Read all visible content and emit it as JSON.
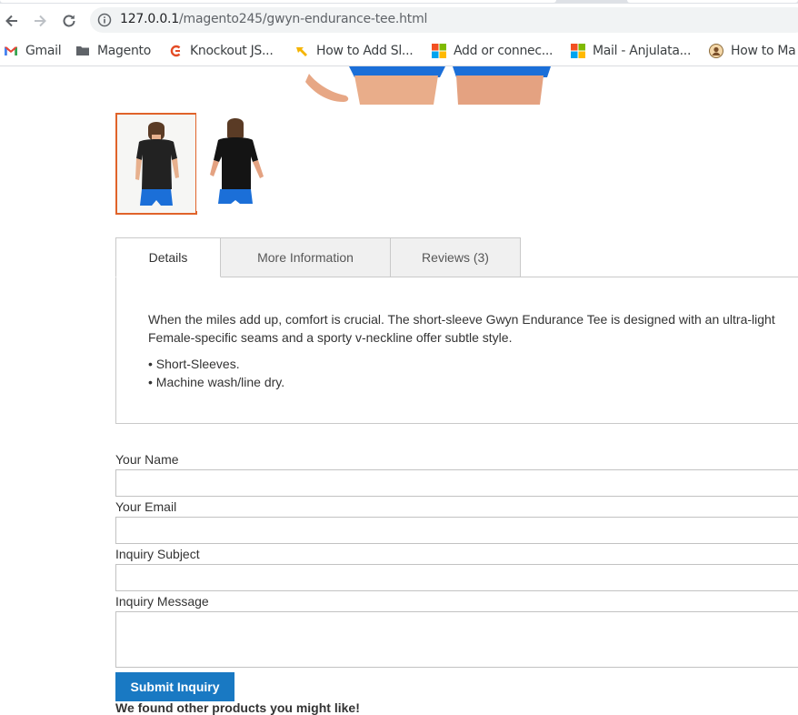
{
  "browser": {
    "url_host": "127.0.0.1",
    "url_path": "/magento245/gwyn-endurance-tee.html",
    "bookmarks": [
      {
        "label": "Gmail",
        "icon": "gmail-icon"
      },
      {
        "label": "Magento",
        "icon": "folder-icon"
      },
      {
        "label": "Knockout JS...",
        "icon": "knockout-icon"
      },
      {
        "label": "How to Add Sl...",
        "icon": "bookmark-arrow-icon"
      },
      {
        "label": "Add or connec...",
        "icon": "microsoft-icon"
      },
      {
        "label": "Mail - Anjulata...",
        "icon": "microsoft-icon"
      },
      {
        "label": "How to Ma",
        "icon": "avatar-icon"
      }
    ]
  },
  "product": {
    "tabs": [
      {
        "label": "Details",
        "active": true
      },
      {
        "label": "More Information",
        "active": false
      },
      {
        "label": "Reviews (3)",
        "active": false
      }
    ],
    "description_line1": "When the miles add up, comfort is crucial. The short-sleeve Gwyn Endurance Tee is designed with an ultra-light",
    "description_line2": "Female-specific seams and a sporty v-neckline offer subtle style.",
    "bullets": [
      "• Short-Sleeves.",
      "• Machine wash/line dry."
    ]
  },
  "inquiry_form": {
    "name_label": "Your Name",
    "email_label": "Your Email",
    "subject_label": "Inquiry Subject",
    "message_label": "Inquiry Message",
    "name_value": "",
    "email_value": "",
    "subject_value": "",
    "message_value": "",
    "submit_label": "Submit Inquiry",
    "cutoff_text": "We found other products you might like!"
  },
  "colors": {
    "accent": "#1979c3",
    "thumb_border": "#e0632a"
  }
}
